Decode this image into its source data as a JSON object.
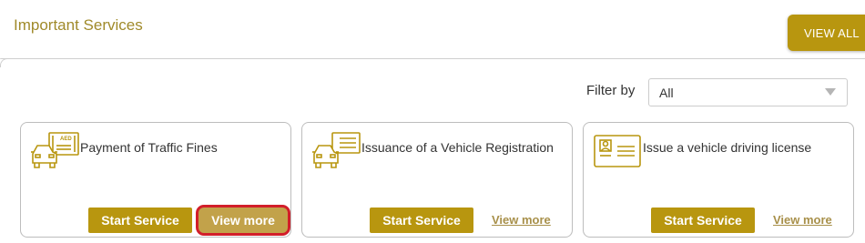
{
  "header": {
    "title": "Important Services",
    "view_all_label": "VIEW ALL"
  },
  "filter": {
    "label": "Filter by",
    "selected": "All"
  },
  "colors": {
    "accent": "#b8960f",
    "highlight": "#d21e2a"
  },
  "cards": [
    {
      "title": "Payment of Traffic Fines",
      "icon": "car-fine-icon",
      "start_label": "Start Service",
      "more_label": "View more"
    },
    {
      "title": "Issuance of a Vehicle Registration",
      "icon": "car-registration-icon",
      "start_label": "Start Service",
      "more_label": "View more"
    },
    {
      "title": "Issue a vehicle driving license",
      "icon": "driving-license-icon",
      "start_label": "Start Service",
      "more_label": "View more"
    }
  ],
  "icon_text": {
    "aed": "AED"
  }
}
